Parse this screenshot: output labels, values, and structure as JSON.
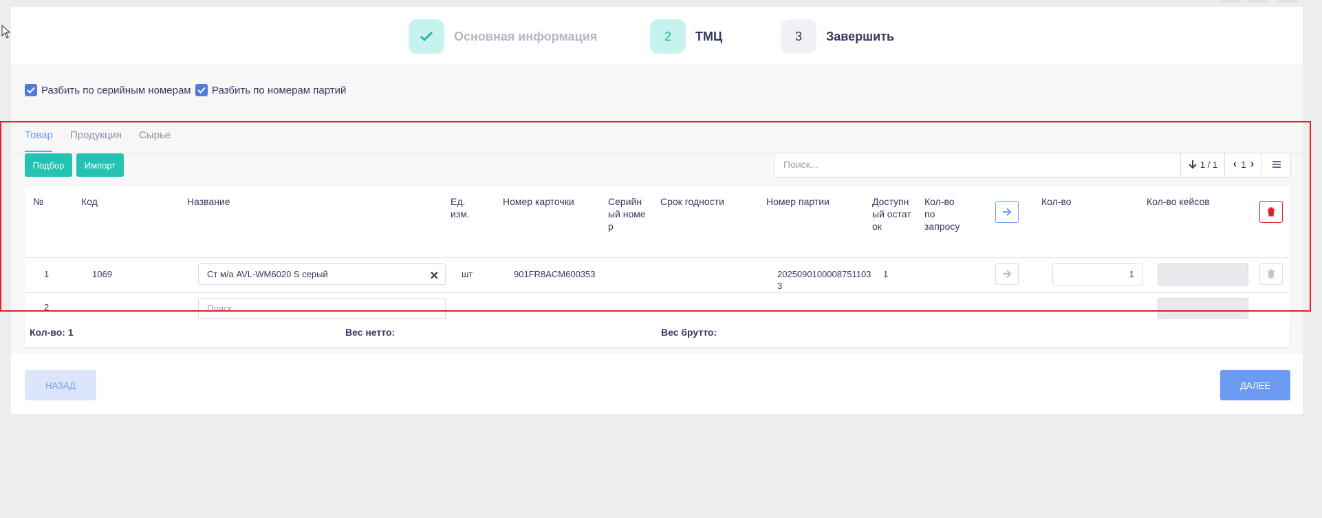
{
  "wizard": {
    "steps": [
      {
        "marker": "",
        "label": "Основная информация"
      },
      {
        "marker": "2",
        "label": "ТМЦ"
      },
      {
        "marker": "3",
        "label": "Завершить"
      }
    ]
  },
  "options": {
    "split_serial": "Разбить по серийным номерам",
    "split_batch": "Разбить по номерам партий"
  },
  "tabs": [
    "Товар",
    "Продукция",
    "Сырье"
  ],
  "toolbar": {
    "select_label": "Подбор",
    "import_label": "Импорт",
    "search_placeholder": "Поиск...",
    "page_range": "1 / 1",
    "page_number": "1"
  },
  "table": {
    "headers": {
      "num": "№",
      "code": "Код",
      "name": "Название",
      "unit": "Ед. изм.",
      "card": "Номер карточки",
      "serial": "Серийный номер",
      "expiry": "Срок годности",
      "batch": "Номер партии",
      "available": "Доступный остаток",
      "requested": "Кол-во по запросу",
      "qty": "Кол-во",
      "cases": "Кол-во кейсов"
    },
    "rows": [
      {
        "num": "1",
        "code": "1069",
        "name": "Ст м/а AVL-WM6020 S серый",
        "unit": "шт",
        "card": "901FR8ACM600353",
        "batch": "20250901000087511033",
        "available": "1",
        "qty": "1"
      },
      {
        "num": "2",
        "name_placeholder": "Поиск..."
      }
    ]
  },
  "totals": {
    "qty": "Кол-во: 1",
    "net": "Вес нетто:",
    "gross": "Вес брутто:"
  },
  "footer": {
    "back_label": "НАЗАД",
    "next_label": "ДАЛЕЕ"
  },
  "colors": {
    "accent_teal": "#23c2b2",
    "primary_blue": "#6b9bf2",
    "danger_red": "#e0202a",
    "highlight_frame": "#e0202a"
  }
}
